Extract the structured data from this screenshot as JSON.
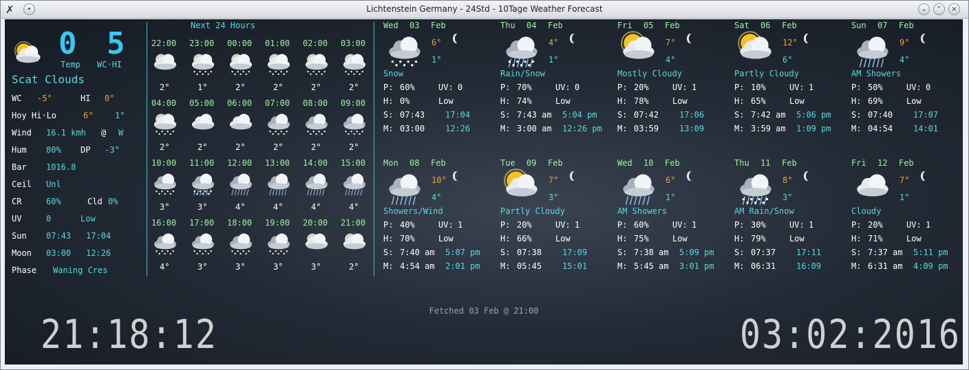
{
  "window": {
    "title": "Lichtenstein Germany - 24Std - 10Tage Weather Forecast"
  },
  "current": {
    "temp": "0",
    "wchi": "5",
    "temp_label": "Temp",
    "wchi_label": "WC·HI",
    "condition": "Scat Clouds",
    "rows": [
      {
        "k": "WC",
        "v": "-5°",
        "k2": "HI",
        "v2": "0°"
      },
      {
        "k": "Hoy Hi·Lo",
        "v": "6°",
        "v2": "1°"
      },
      {
        "k": "Wind",
        "v": "16.1 kmh",
        "k2": "@",
        "v2": "W"
      },
      {
        "k": "Hum",
        "v": "80%",
        "k2": "DP",
        "v2": "-3°"
      },
      {
        "k": "Bar",
        "v": "1016.8"
      },
      {
        "k": "Ceil",
        "v": "Unl"
      },
      {
        "k": "CR",
        "v": "60%",
        "k2": "Cld",
        "v2": "0%"
      },
      {
        "k": "UV",
        "v": "0",
        "v2": "Low"
      },
      {
        "k": "Sun",
        "v": "07:43",
        "v2": "17:04"
      },
      {
        "k": "Moon",
        "v": "03:00",
        "v2": "12:26"
      },
      {
        "k": "Phase",
        "v": "Waning Cres"
      }
    ]
  },
  "hourly": {
    "title": "Next 24 Hours",
    "hours": [
      {
        "time": "22:00",
        "temp": "2°",
        "icon": "moon-cloud"
      },
      {
        "time": "23:00",
        "temp": "1°",
        "icon": "moon-snow"
      },
      {
        "time": "00:00",
        "temp": "2°",
        "icon": "moon-snow"
      },
      {
        "time": "01:00",
        "temp": "2°",
        "icon": "moon-snow"
      },
      {
        "time": "02:00",
        "temp": "2°",
        "icon": "moon-snow"
      },
      {
        "time": "03:00",
        "temp": "2°",
        "icon": "moon-snow"
      },
      {
        "time": "04:00",
        "temp": "2°",
        "icon": "moon-snow"
      },
      {
        "time": "05:00",
        "temp": "2°",
        "icon": "cloud"
      },
      {
        "time": "06:00",
        "temp": "2°",
        "icon": "cloud"
      },
      {
        "time": "07:00",
        "temp": "2°",
        "icon": "cloud-snow"
      },
      {
        "time": "08:00",
        "temp": "2°",
        "icon": "cloud-snow"
      },
      {
        "time": "09:00",
        "temp": "2°",
        "icon": "cloud-snow"
      },
      {
        "time": "10:00",
        "temp": "3°",
        "icon": "cloud-snow"
      },
      {
        "time": "11:00",
        "temp": "3°",
        "icon": "cloud-rainsnow"
      },
      {
        "time": "12:00",
        "temp": "4°",
        "icon": "cloud-rain"
      },
      {
        "time": "13:00",
        "temp": "4°",
        "icon": "cloud-rain"
      },
      {
        "time": "14:00",
        "temp": "4°",
        "icon": "cloud-rain"
      },
      {
        "time": "15:00",
        "temp": "4°",
        "icon": "cloud-rain"
      },
      {
        "time": "16:00",
        "temp": "4°",
        "icon": "cloud-snow"
      },
      {
        "time": "17:00",
        "temp": "3°",
        "icon": "cloud-snow"
      },
      {
        "time": "18:00",
        "temp": "3°",
        "icon": "cloud-snow"
      },
      {
        "time": "19:00",
        "temp": "3°",
        "icon": "cloud-snow"
      },
      {
        "time": "20:00",
        "temp": "3°",
        "icon": "moon-cloud"
      },
      {
        "time": "21:00",
        "temp": "2°",
        "icon": "moon-cloud"
      }
    ]
  },
  "days": [
    {
      "day": "Wed",
      "date": "03",
      "month": "Feb",
      "hi": "6°",
      "lo": "1°",
      "cond": "Snow",
      "p": "60%",
      "uv": "0",
      "h": "0%",
      "uvl": "Low",
      "sr": "07:43",
      "ss": "17:04",
      "mr": "03:00",
      "ms": "12:26",
      "icon": "cloud-snow"
    },
    {
      "day": "Thu",
      "date": "04",
      "month": "Feb",
      "hi": "4°",
      "lo": "1°",
      "cond": "Rain/Snow",
      "p": "70%",
      "uv": "0",
      "h": "74%",
      "uvl": "Low",
      "sr": "7:43 am",
      "ss": "5:04 pm",
      "mr": "3:00 am",
      "ms": "12:26 pm",
      "icon": "cloud-rainsnow"
    },
    {
      "day": "Fri",
      "date": "05",
      "month": "Feb",
      "hi": "7°",
      "lo": "4°",
      "cond": "Mostly Cloudy",
      "p": "20%",
      "uv": "1",
      "h": "78%",
      "uvl": "Low",
      "sr": "07:42",
      "ss": "17:06",
      "mr": "03:59",
      "ms": "13:09",
      "icon": "sun-cloud"
    },
    {
      "day": "Sat",
      "date": "06",
      "month": "Feb",
      "hi": "12°",
      "lo": "6°",
      "cond": "Partly Cloudy",
      "p": "10%",
      "uv": "1",
      "h": "65%",
      "uvl": "Low",
      "sr": "7:42 am",
      "ss": "5:06 pm",
      "mr": "3:59 am",
      "ms": "1:09 pm",
      "icon": "sun-cloud"
    },
    {
      "day": "Sun",
      "date": "07",
      "month": "Feb",
      "hi": "9°",
      "lo": "4°",
      "cond": "AM Showers",
      "p": "50%",
      "uv": "0",
      "h": "69%",
      "uvl": "Low",
      "sr": "07:40",
      "ss": "17:07",
      "mr": "04:54",
      "ms": "14:01",
      "icon": "cloud-rain"
    },
    {
      "day": "Mon",
      "date": "08",
      "month": "Feb",
      "hi": "10°",
      "lo": "4°",
      "cond": "Showers/Wind",
      "p": "40%",
      "uv": "1",
      "h": "70%",
      "uvl": "Low",
      "sr": "7:40 am",
      "ss": "5:07 pm",
      "mr": "4:54 am",
      "ms": "2:01 pm",
      "icon": "cloud-rain"
    },
    {
      "day": "Tue",
      "date": "09",
      "month": "Feb",
      "hi": "7°",
      "lo": "3°",
      "cond": "Partly Cloudy",
      "p": "20%",
      "uv": "1",
      "h": "66%",
      "uvl": "Low",
      "sr": "07:38",
      "ss": "17:09",
      "mr": "05:45",
      "ms": "15:01",
      "icon": "sun-cloud"
    },
    {
      "day": "Wed",
      "date": "10",
      "month": "Feb",
      "hi": "6°",
      "lo": "1°",
      "cond": "AM Showers",
      "p": "60%",
      "uv": "1",
      "h": "75%",
      "uvl": "Low",
      "sr": "7:38 am",
      "ss": "5:09 pm",
      "mr": "5:45 am",
      "ms": "3:01 pm",
      "icon": "cloud-rain"
    },
    {
      "day": "Thu",
      "date": "11",
      "month": "Feb",
      "hi": "8°",
      "lo": "3°",
      "cond": "AM Rain/Snow",
      "p": "30%",
      "uv": "1",
      "h": "79%",
      "uvl": "Low",
      "sr": "07:37",
      "ss": "17:11",
      "mr": "06:31",
      "ms": "16:09",
      "icon": "cloud-rainsnow"
    },
    {
      "day": "Fri",
      "date": "12",
      "month": "Feb",
      "hi": "7°",
      "lo": "1°",
      "cond": "Cloudy",
      "p": "20%",
      "uv": "1",
      "h": "71%",
      "uvl": "Low",
      "sr": "7:37 am",
      "ss": "5:11 pm",
      "mr": "6:31 am",
      "ms": "4:09 pm",
      "icon": "cloud"
    }
  ],
  "labels": {
    "p": "P:",
    "uv": "UV:",
    "h": "H:",
    "s": "S:",
    "m": "M:"
  },
  "footer": {
    "fetched": "Fetched 03 Feb @ 21:00",
    "clock": "21:18:12",
    "date": "03:02:2016"
  }
}
